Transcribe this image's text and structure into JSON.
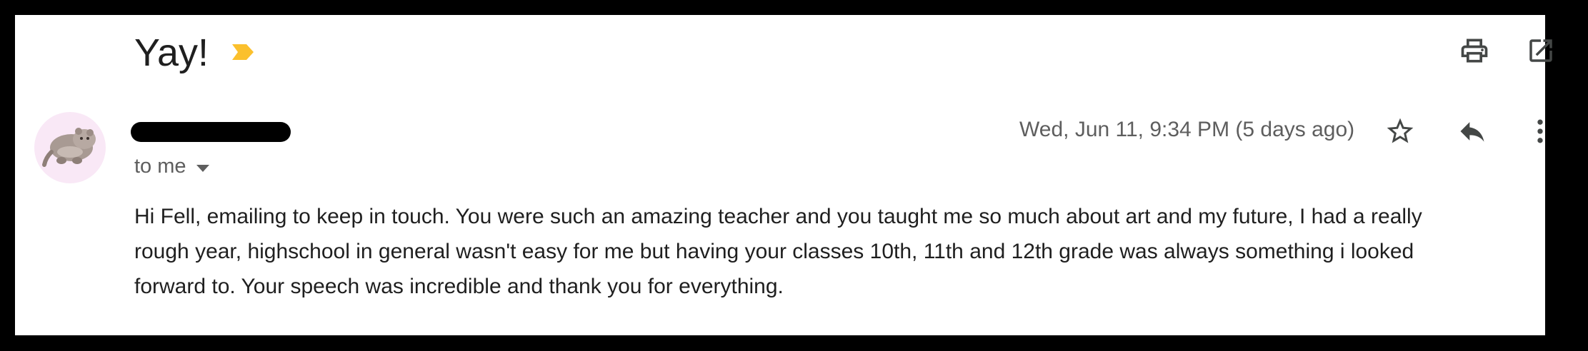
{
  "email": {
    "subject": "Yay!",
    "date": "Wed, Jun 11, 9:34 PM (5 days ago)",
    "recipient": "to me",
    "body_lines": [
      "Hi Fell, emailing to keep in touch. You were such an amazing teacher and you taught me so much about art and my future, I had a really",
      "rough year, highschool in general wasn't easy for me but having your classes 10th, 11th and 12th grade was always something i looked",
      "forward to. Your speech was incredible and thank you for everything."
    ]
  },
  "colors": {
    "importance_marker": "#fbc02d",
    "icon": "#444746",
    "avatar_bg": "#f9e8f6"
  },
  "icons": {
    "importance": "importance-marker-icon",
    "print": "print-icon",
    "open_new_window": "open-in-new-icon",
    "star": "star-icon",
    "reply": "reply-icon",
    "more": "more-vert-icon",
    "recipient_caret": "caret-down-icon"
  }
}
